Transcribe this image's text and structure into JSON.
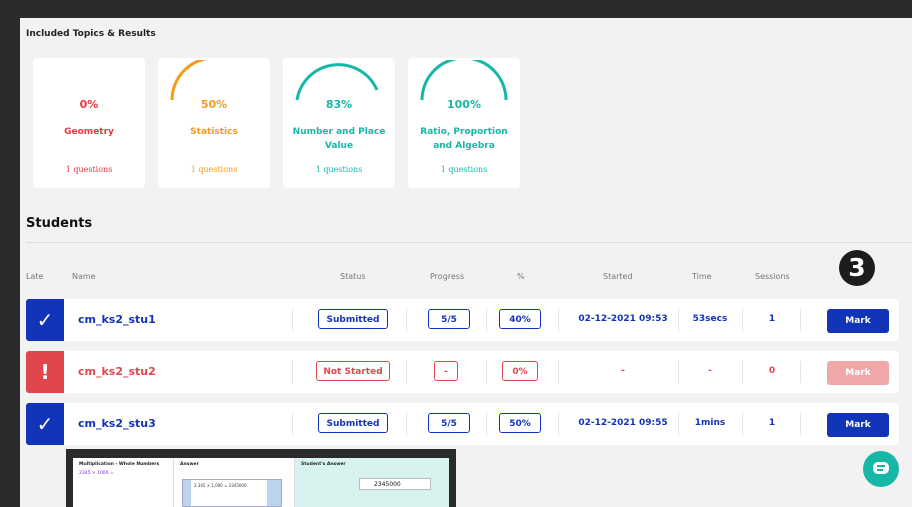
{
  "topics_section": {
    "title": "Included Topics & Results",
    "topics": [
      {
        "percent": "0%",
        "name": "Geometry",
        "questions": "1 questions",
        "progress": 0,
        "color": "#e13a40"
      },
      {
        "percent": "50%",
        "name": "Statistics",
        "questions": "1 questions",
        "progress": 0.5,
        "color": "#f49b1c"
      },
      {
        "percent": "83%",
        "name": "Number and Place Value",
        "questions": "1 questions",
        "progress": 0.83,
        "color": "#16b7a6"
      },
      {
        "percent": "100%",
        "name": "Ratio, Proportion and Algebra",
        "questions": "1 questions",
        "progress": 1.0,
        "color": "#16b7a6"
      }
    ]
  },
  "students_section": {
    "title": "Students",
    "step_badge": "3",
    "columns": {
      "late": "Late",
      "name": "Name",
      "status": "Status",
      "progress": "Progress",
      "percent": "%",
      "started": "Started",
      "time": "Time",
      "sessions": "Sessions"
    },
    "rows": [
      {
        "late_icon": "check-icon",
        "name": "cm_ks2_stu1",
        "status": "Submitted",
        "progress": "5/5",
        "percent": "40%",
        "started": "02-12-2021 09:53",
        "time": "53secs",
        "sessions": "1",
        "mark": "Mark",
        "mark_enabled": true
      },
      {
        "late_icon": "exclamation-icon",
        "name": "cm_ks2_stu2",
        "status": "Not Started",
        "progress": "-",
        "percent": "0%",
        "started": "-",
        "time": "-",
        "sessions": "0",
        "mark": "Mark",
        "mark_enabled": false
      },
      {
        "late_icon": "check-icon",
        "name": "cm_ks2_stu3",
        "status": "Submitted",
        "progress": "5/5",
        "percent": "50%",
        "started": "02-12-2021 09:55",
        "time": "1mins",
        "sessions": "1",
        "mark": "Mark",
        "mark_enabled": true
      }
    ]
  },
  "preview_thumbnail": {
    "question_title": "Multiplication - Whole Numbers",
    "question": "2345 × 1000 =",
    "answer_title": "Answer",
    "pupil_working": "2,345 × 1,000 = 2345000",
    "students_answer_title": "Student's Answer",
    "students_answer": "2345000"
  },
  "chat_icon": "chat-icon"
}
